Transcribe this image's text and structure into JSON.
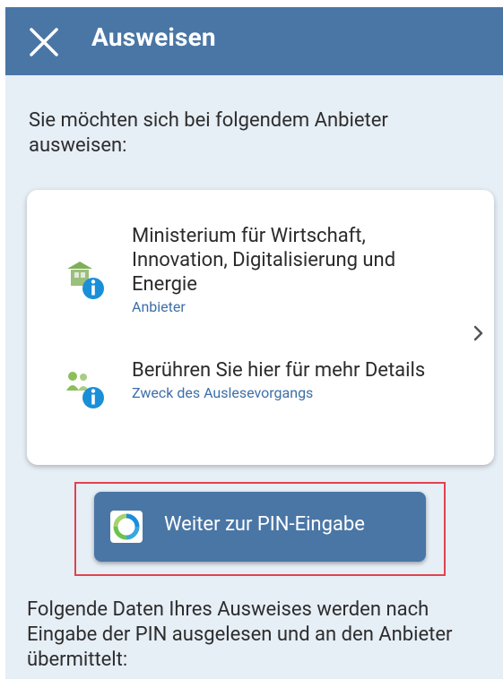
{
  "appbar": {
    "title": "Ausweisen",
    "close_icon": "close-icon"
  },
  "intro": {
    "text": "Sie möchten sich bei folgendem Anbieter ausweisen:"
  },
  "card": {
    "rows": [
      {
        "icon": "provider-info-icon",
        "title": "Ministerium für Wirtschaft, Innovation, Digitalisierung und Energie",
        "subtitle": "Anbieter"
      },
      {
        "icon": "purpose-info-icon",
        "title": "Berühren Sie hier für mehr Details",
        "subtitle": "Zweck des Auslesevorgangs"
      }
    ],
    "chevron_icon": "chevron-right-icon"
  },
  "pin_button": {
    "label": "Weiter zur PIN-Eingabe",
    "icon": "ausweisapp-logo-icon"
  },
  "footer": {
    "text": "Folgende Daten Ihres Ausweises werden nach Eingabe der PIN ausgelesen und an den Anbieter übermittelt:"
  },
  "colors": {
    "primary": "#4a76a6",
    "background": "#e6eef6",
    "link": "#3d6fa8",
    "info_blue": "#1a8fd8",
    "highlight_red": "#e0434d"
  }
}
